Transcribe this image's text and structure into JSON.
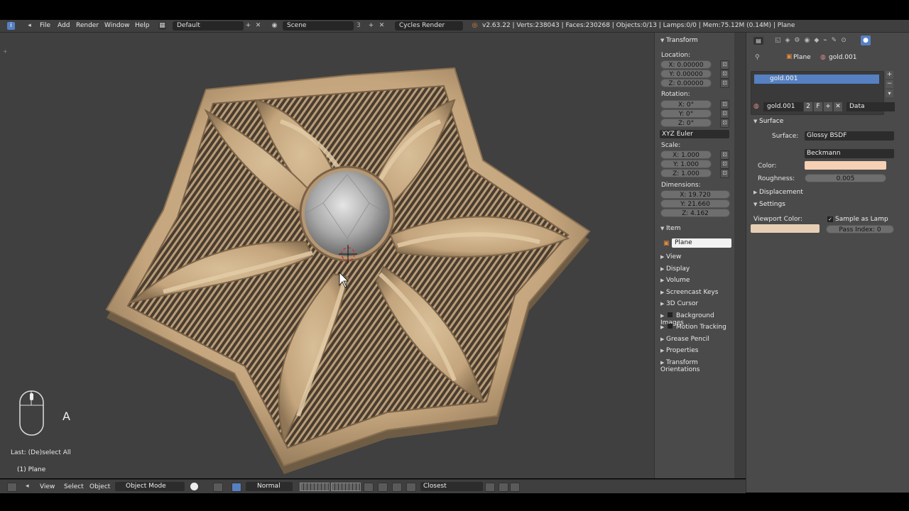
{
  "topbar": {
    "menus": [
      "File",
      "Add",
      "Render",
      "Window",
      "Help"
    ],
    "layout": "Default",
    "scene": "Scene",
    "scene_count": "3",
    "engine": "Cycles Render",
    "stats": "v2.63.22 | Verts:238043 | Faces:230268 | Objects:0/13 | Lamps:0/0 | Mem:75.12M (0.14M) | Plane"
  },
  "viewport": {
    "last_op": "Last: (De)select All",
    "active": "(1) Plane",
    "key": "A"
  },
  "npanel": {
    "transform_header": "Transform",
    "location_label": "Location:",
    "loc_x": "X: 0.00000",
    "loc_y": "Y: 0.00000",
    "loc_z": "Z: 0.00000",
    "rotation_label": "Rotation:",
    "rot_x": "X: 0°",
    "rot_y": "Y: 0°",
    "rot_z": "Z: 0°",
    "rot_mode": "XYZ Euler",
    "scale_label": "Scale:",
    "sc_x": "X: 1.000",
    "sc_y": "Y: 1.000",
    "sc_z": "Z: 1.000",
    "dimensions_label": "Dimensions:",
    "dim_x": "X: 19.720",
    "dim_y": "Y: 21.660",
    "dim_z": "Z: 4.162",
    "item_header": "Item",
    "item_name": "Plane",
    "panels": [
      "View",
      "Display",
      "Volume",
      "Screencast Keys",
      "3D Cursor",
      "Background Images",
      "Motion Tracking",
      "Grease Pencil",
      "Properties",
      "Transform Orientations"
    ]
  },
  "props": {
    "breadcrumb_object": "Plane",
    "breadcrumb_material": "gold.001",
    "slot": "gold.001",
    "mat_name": "gold.001",
    "mat_users": "2",
    "mat_fake": "F",
    "link": "Data",
    "surface_header": "Surface",
    "surface_label": "Surface:",
    "surface_value": "Glossy BSDF",
    "distribution": "Beckmann",
    "color_label": "Color:",
    "color_value": "#f5d0b4",
    "roughness_label": "Roughness:",
    "roughness_value": "0.005",
    "displacement_header": "Displacement",
    "settings_header": "Settings",
    "viewport_color_label": "Viewport Color:",
    "viewport_color_value": "#e6cfb4",
    "sample_lamp": "Sample as Lamp",
    "pass_index": "Pass Index: 0"
  },
  "bottombar": {
    "view": "View",
    "select": "Select",
    "object": "Object",
    "mode": "Object Mode",
    "orientation": "Normal",
    "snap": "Closest"
  },
  "colors": {
    "gold": "#c9ad87",
    "gold_dark": "#8c7558",
    "accent_blue": "#5680c2"
  }
}
